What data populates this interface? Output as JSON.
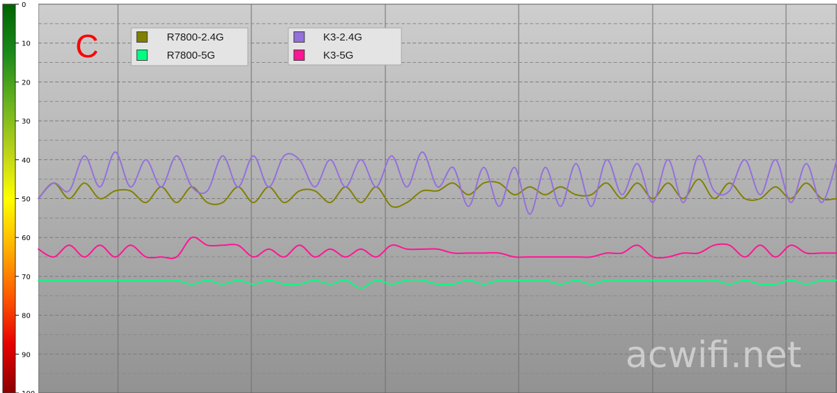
{
  "chart_data": {
    "type": "line",
    "panel_marker": "C",
    "watermark": "acwifi.net",
    "y_axis": {
      "ticks": [
        0,
        10,
        20,
        30,
        40,
        50,
        60,
        70,
        80,
        90,
        100
      ],
      "tick_labels": [
        "0",
        "10",
        "20",
        "30",
        "40",
        "50",
        "60",
        "70",
        "80",
        "90",
        "100"
      ],
      "ylim": [
        0,
        100
      ],
      "inverted": true,
      "color_scale": [
        "#006400",
        "#1a8a1a",
        "#66b21e",
        "#b8d11a",
        "#ffff00",
        "#ffb300",
        "#ff5a00",
        "#e60000",
        "#8b0000"
      ]
    },
    "x_samples": 53,
    "grid": true,
    "legend": {
      "groups": [
        [
          {
            "label": "R7800-2.4G",
            "color": "#808000"
          },
          {
            "label": "R7800-5G",
            "color": "#00ff80"
          }
        ],
        [
          {
            "label": "K3-2.4G",
            "color": "#9370db"
          },
          {
            "label": "K3-5G",
            "color": "#ff1493"
          }
        ]
      ]
    },
    "series": [
      {
        "name": "R7800-2.4G",
        "color": "#808000",
        "values": [
          50,
          46,
          50,
          46,
          50,
          48,
          48,
          51,
          47,
          51,
          47,
          51,
          51,
          47,
          51,
          47,
          51,
          48,
          48,
          51,
          47,
          51,
          47,
          52,
          51,
          48,
          48,
          46,
          49,
          46,
          46,
          49,
          47,
          49,
          47,
          49,
          49,
          46,
          50,
          46,
          50,
          46,
          50,
          45,
          50,
          46,
          50,
          50,
          47,
          50,
          46,
          50,
          50
        ]
      },
      {
        "name": "R7800-5G",
        "color": "#00ff80",
        "values": [
          71,
          71,
          71,
          71,
          71,
          71,
          71,
          71,
          71,
          71,
          72,
          71,
          72,
          71,
          72,
          71,
          72,
          72,
          71,
          72,
          71,
          73,
          71,
          72,
          71,
          71,
          72,
          72,
          71,
          72,
          71,
          71,
          71,
          71,
          72,
          71,
          72,
          71,
          71,
          71,
          71,
          71,
          71,
          71,
          71,
          72,
          71,
          72,
          72,
          71,
          72,
          71,
          71
        ]
      },
      {
        "name": "K3-2.4G",
        "color": "#9370db",
        "values": [
          50,
          46,
          48,
          39,
          47,
          38,
          47,
          40,
          47,
          39,
          47,
          48,
          39,
          47,
          39,
          47,
          39,
          40,
          47,
          40,
          47,
          40,
          47,
          39,
          47,
          38,
          47,
          42,
          52,
          42,
          52,
          42,
          54,
          42,
          52,
          41,
          52,
          40,
          49,
          41,
          51,
          40,
          51,
          39,
          48,
          48,
          40,
          49,
          40,
          51,
          41,
          51,
          40
        ]
      },
      {
        "name": "K3-5G",
        "color": "#ff1493",
        "values": [
          63,
          65,
          62,
          65,
          62,
          65,
          62,
          65,
          65,
          65,
          60,
          62,
          62,
          62,
          65,
          63,
          65,
          62,
          65,
          63,
          65,
          63,
          65,
          62,
          63,
          63,
          63,
          64,
          64,
          64,
          64,
          65,
          65,
          65,
          65,
          65,
          65,
          64,
          64,
          62,
          65,
          65,
          64,
          64,
          62,
          62,
          65,
          62,
          65,
          62,
          64,
          64,
          64
        ]
      }
    ]
  }
}
